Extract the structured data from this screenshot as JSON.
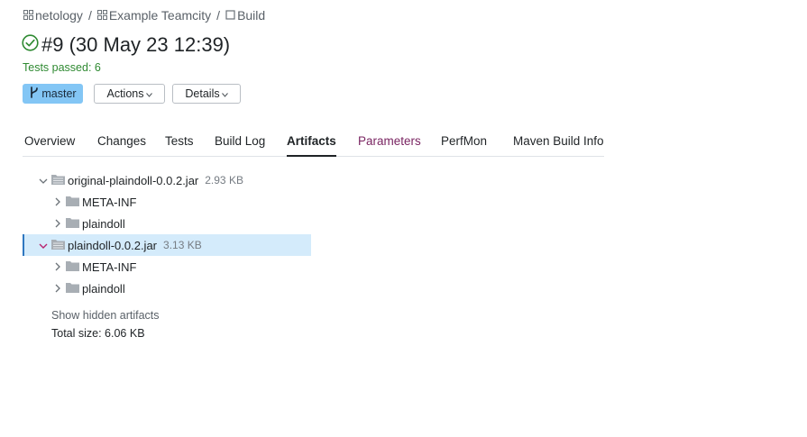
{
  "breadcrumb": {
    "items": [
      {
        "label": "netology",
        "icon": "project-grid-icon"
      },
      {
        "label": "Example Teamcity",
        "icon": "project-grid-icon"
      },
      {
        "label": "Build",
        "icon": "build-config-icon"
      }
    ],
    "separator": "/"
  },
  "build": {
    "title": "#9 (30 May 23 12:39)",
    "status_icon": "success-check-icon",
    "status_color": "#2f8a32",
    "tests_summary": "Tests passed: 6"
  },
  "actions": {
    "branch_label": "master",
    "branch_color": "#83c6f5",
    "actions_label": "Actions",
    "details_label": "Details"
  },
  "tabs": [
    {
      "label": "Overview",
      "active": false
    },
    {
      "label": "Changes",
      "active": false
    },
    {
      "label": "Tests",
      "active": false
    },
    {
      "label": "Build Log",
      "active": false
    },
    {
      "label": "Artifacts",
      "active": true
    },
    {
      "label": "Parameters",
      "active": false
    },
    {
      "label": "PerfMon",
      "active": false
    },
    {
      "label": "Maven Build Info",
      "active": false
    }
  ],
  "artifacts": {
    "items": [
      {
        "name": "original-plaindoll-0.0.2.jar",
        "size": "2.93 KB",
        "type": "archive",
        "expanded": true,
        "selected": false,
        "children": [
          {
            "name": "META-INF"
          },
          {
            "name": "plaindoll"
          }
        ]
      },
      {
        "name": "plaindoll-0.0.2.jar",
        "size": "3.13 KB",
        "type": "archive",
        "expanded": true,
        "selected": true,
        "children": [
          {
            "name": "META-INF"
          },
          {
            "name": "plaindoll"
          }
        ]
      }
    ],
    "show_hidden_label": "Show hidden artifacts",
    "total_size": "Total size: 6.06 KB"
  }
}
